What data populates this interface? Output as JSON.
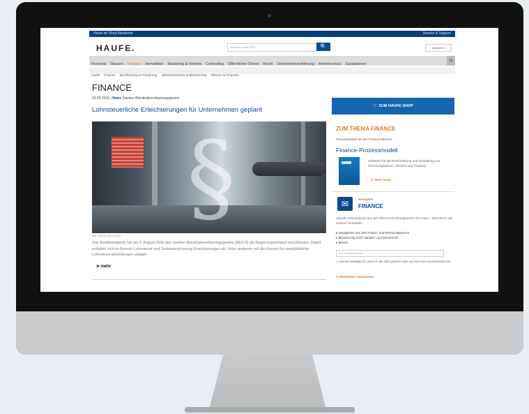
{
  "topbar": {
    "left": "Haufe.de  Shop  Akademie",
    "right": "Service & Support"
  },
  "logo": "HAUFE.",
  "search": {
    "placeholder": "Wonach suchen Sie?",
    "button": "🔍"
  },
  "login_label": "Anmelden",
  "nav": {
    "items": [
      "Personal",
      "Steuern",
      "Finance",
      "Immobilien",
      "Marketing & Vertrieb",
      "Controlling",
      "Öffentlicher Dienst",
      "Recht",
      "Unternehmensführung",
      "Arbeitsschutz",
      "Sozialwesen"
    ],
    "active_index": 2,
    "more": "»"
  },
  "subnav": [
    "Haufe",
    "Finance",
    "Buchführung & Kontierung",
    "Jahresabschluss & Bilanzierung",
    "Steuern & Finanzen"
  ],
  "page_title": "FINANCE",
  "article": {
    "date": "03.09.2016",
    "category": "News",
    "kicker": "Zweites Bürokratieentlastungsgesetz",
    "headline": "Lohnsteuerliche Erleichterungen für Unternehmen geplant",
    "credit": "Bild: Michael Bamberger",
    "teaser": "Das Bundeskabinett hat am 3. August 2016 den zweiten Bürokratieentlastungsgesetz (BEG II) als Regierungsentwurf beschlossen. Damit entfallen sich im Bereich Lohnsteuer und Sozialversicherung Erleichterungen ab. Unter anderem soll die Grenze für vierteljährliche Lohnsteueranmeldungen steigen.",
    "more": "mehr"
  },
  "sidebar": {
    "shop_button": "🛒 ZUM HAUFE SHOP",
    "thema_title": "ZUM THEMA FINANCE",
    "pm_label": "Prozessmodell für den Finance-Bereich",
    "pm_title": "Finance-Prozessmodell",
    "pm_desc": "Leitfaden für die Beschreibung und Gestaltung von Rechnungswesen, Steuern und Treasury",
    "pm_more": "Mehr lesen",
    "nl_label": "Newsletter",
    "nl_title": "FINANCE",
    "nl_text": "Aktuelle Informationen aus dem Bereich Rechnungswesen frei Haus – abonnieren Sie unseren Newsletter:",
    "nl_list": [
      "Neuigkeiten aus dem Finanz- und Rechnungswesen",
      "Bilanzierung nach Handels- und Steuerrecht",
      "BilMoG"
    ],
    "nl_input_placeholder": "Ihre E-Mail-Adresse",
    "nl_check": "Hiermit bestätige ich, dass ich die AGB gelesen habe und mit ihnen einverstanden bin.",
    "nl_button": "Newsletter abonnieren"
  }
}
